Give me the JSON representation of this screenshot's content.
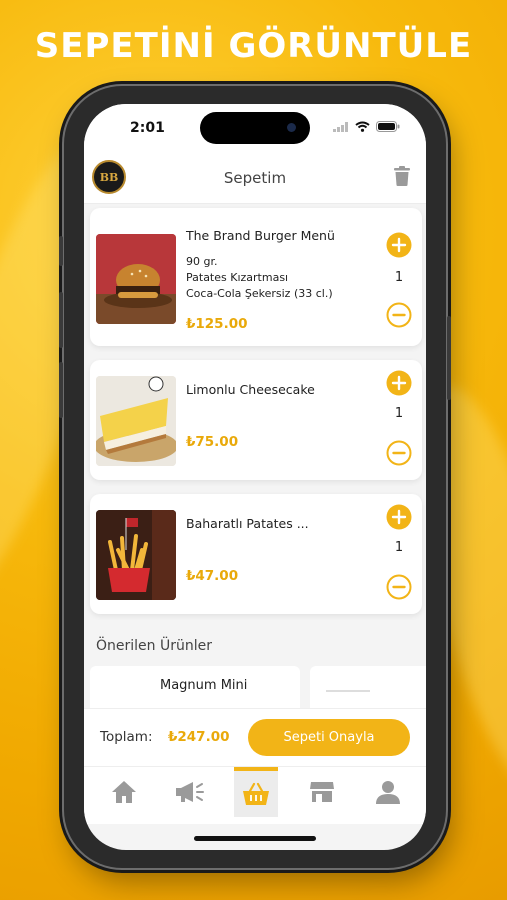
{
  "promo": {
    "title": "SEPETİNİ GÖRÜNTÜLE"
  },
  "status_bar": {
    "time": "2:01"
  },
  "header": {
    "title": "Sepetim",
    "logo_text": "BB"
  },
  "cart_items": [
    {
      "name": "The Brand Burger Menü",
      "desc": [
        "90 gr.",
        "Patates Kızartması",
        "Coca-Cola Şekersiz (33 cl.)"
      ],
      "price": "₺125.00",
      "qty": "1",
      "image": "burger"
    },
    {
      "name": "Limonlu Cheesecake",
      "desc": [],
      "price": "₺75.00",
      "qty": "1",
      "image": "cheesecake"
    },
    {
      "name": "Baharatlı Patates ...",
      "desc": [],
      "price": "₺47.00",
      "qty": "1",
      "image": "fries"
    }
  ],
  "suggestions": {
    "title": "Önerilen Ürünler",
    "items": [
      {
        "name": "Magnum Mini"
      }
    ]
  },
  "checkout": {
    "total_label": "Toplam:",
    "total_value": "₺247.00",
    "confirm_label": "Sepeti Onayla"
  },
  "tabs": [
    {
      "icon": "home-icon"
    },
    {
      "icon": "megaphone-icon"
    },
    {
      "icon": "basket-icon",
      "active": true
    },
    {
      "icon": "store-icon"
    },
    {
      "icon": "user-icon"
    }
  ],
  "colors": {
    "accent": "#f2b417",
    "price": "#e9a90a",
    "background": "#f7b90c"
  }
}
